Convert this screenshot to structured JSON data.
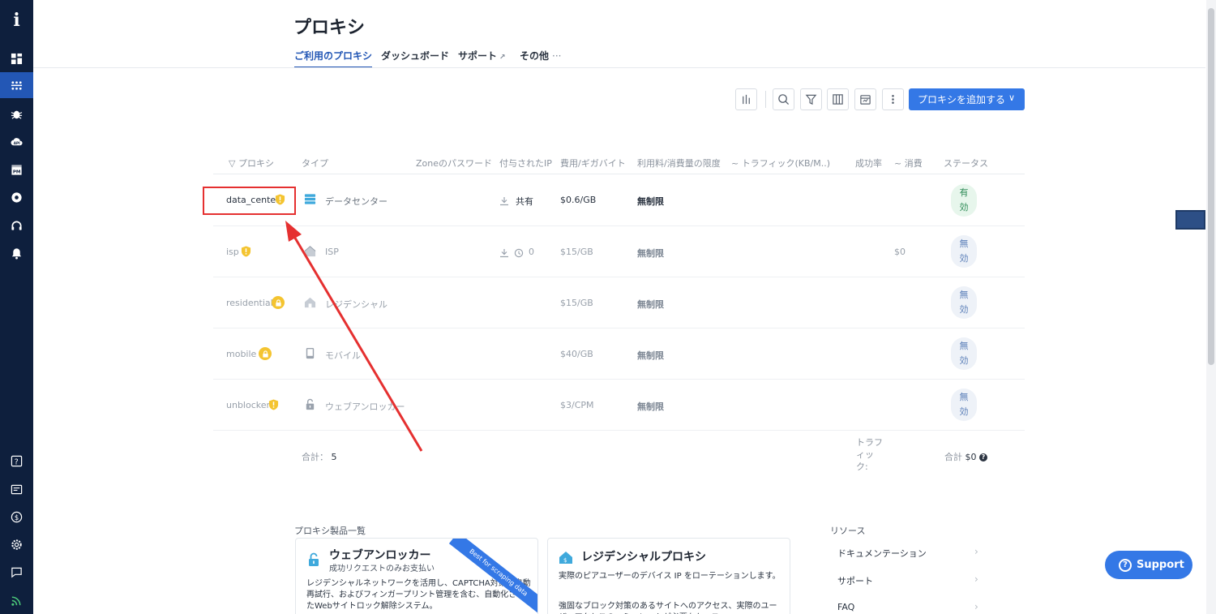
{
  "sidebar": {
    "logo": "i",
    "items": [
      {
        "icon": "dashboard-icon"
      },
      {
        "icon": "proxy-network-icon",
        "active": true
      },
      {
        "icon": "bug-icon"
      },
      {
        "icon": "api-cloud-icon"
      },
      {
        "icon": "pm-icon"
      },
      {
        "icon": "browser-icon"
      },
      {
        "icon": "headset-icon"
      },
      {
        "icon": "bell-icon"
      }
    ],
    "bottom_items": [
      {
        "icon": "help-icon"
      },
      {
        "icon": "billing-icon"
      },
      {
        "icon": "dollar-icon"
      },
      {
        "icon": "settings-icon"
      },
      {
        "icon": "chat-icon"
      },
      {
        "icon": "rss-icon"
      }
    ],
    "api_label": "API",
    "pm_label": "PM"
  },
  "header": {
    "title": "プロキシ",
    "tabs": [
      {
        "label": "ご利用のプロキシ",
        "active": true
      },
      {
        "label": "ダッシュボード"
      },
      {
        "label": "サポート",
        "external": true
      },
      {
        "label": "その他",
        "more": "···"
      }
    ]
  },
  "toolbar": {
    "icons": [
      "chart-icon",
      "search-icon",
      "filter-icon",
      "columns-icon",
      "calendar-icon",
      "more-vertical-icon"
    ],
    "add_button": "プロキシを追加する",
    "add_chevron": "∨"
  },
  "table": {
    "headers": {
      "proxy": "プロキシ",
      "type": "タイプ",
      "password": "Zoneのパスワード",
      "ip": "付与されたIP",
      "cost": "費用/ギガバイト",
      "limit": "利用料/消費量の限度",
      "traffic": "トラフィック(KB/M..)",
      "success": "成功率",
      "spend": "消費",
      "status": "ステータス"
    },
    "rows": [
      {
        "name": "data_center",
        "badge": "shield",
        "type": "データセンター",
        "type_icon": "datacenter-icon",
        "ip": "共有",
        "cost": "$0.6/GB",
        "limit": "無制限",
        "spend": "",
        "status": "有効",
        "active": true
      },
      {
        "name": "isp",
        "badge": "shield",
        "type": "ISP",
        "type_icon": "isp-icon",
        "ip": "0",
        "cost": "$15/GB",
        "limit": "無制限",
        "spend": "$0",
        "status": "無効",
        "active": false
      },
      {
        "name": "residential",
        "badge": "lock",
        "type": "レジデンシャル",
        "type_icon": "home-icon",
        "ip": "",
        "cost": "$15/GB",
        "limit": "無制限",
        "spend": "",
        "status": "無効",
        "active": false
      },
      {
        "name": "mobile",
        "badge": "lock",
        "type": "モバイル",
        "type_icon": "mobile-icon",
        "ip": "",
        "cost": "$40/GB",
        "limit": "無制限",
        "spend": "",
        "status": "無効",
        "active": false
      },
      {
        "name": "unblocker",
        "badge": "shield",
        "type": "ウェブアンロッカー",
        "type_icon": "unlock-icon",
        "ip": "",
        "cost": "$3/CPM",
        "limit": "無制限",
        "spend": "",
        "status": "無効",
        "active": false
      }
    ],
    "total_label": "合計：",
    "total_count": "5",
    "traffic_label": "トラフィック:",
    "total_cost_label": "合計",
    "total_cost_value": "$0"
  },
  "products": {
    "title": "プロキシ製品一覧",
    "cards": [
      {
        "title": "ウェブアンロッカー",
        "subtitle": "成功リクエストのみお支払い",
        "ribbon": "Best for scraping data",
        "desc": "レジデンシャルネットワークを活用し、CAPTCHA対策、自動再試行、およびフィンガープリント管理を含む、自動化されたWebサイトロック解除システム。"
      },
      {
        "title": "レジデンシャルプロキシ",
        "subtitle": "",
        "desc": "実際のピアユーザーのデバイス IP をローテーションします。",
        "desc2": "強固なブロック対策のあるサイトへのアクセス、実際のユーザーアクセスのエミュレートが必要なケース"
      }
    ]
  },
  "resources": {
    "title": "リソース",
    "items": [
      "ドキュメンテーション",
      "サポート",
      "FAQ"
    ]
  },
  "support_button": "Support"
}
